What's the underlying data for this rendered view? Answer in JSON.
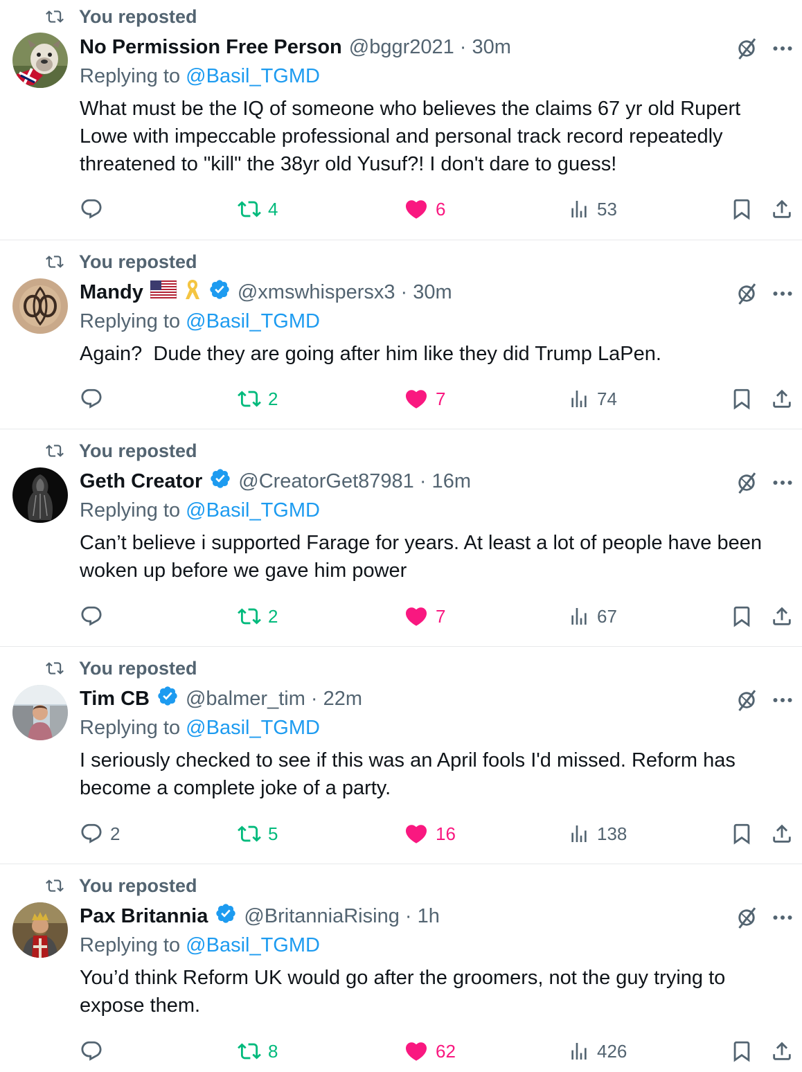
{
  "repost_label": "You reposted",
  "reply_prefix": "Replying to ",
  "icons": {
    "repost": "repost-icon",
    "reply": "reply-icon",
    "like": "heart-filled-icon",
    "views": "views-icon",
    "bookmark": "bookmark-icon",
    "share": "share-icon",
    "grok": "grok-icon",
    "more": "more-icon",
    "verified": "verified-badge-icon"
  },
  "colors": {
    "text": "#0f1419",
    "muted": "#536471",
    "link": "#1d9bf0",
    "repost_green": "#00ba7c",
    "like_pink": "#f91880",
    "divider": "#e7e9ea"
  },
  "posts": [
    {
      "name": "No Permission Free Person",
      "handle": "@bggr2021 · 30m",
      "reply_to": "@Basil_TGMD",
      "text": "What must be the IQ of someone who believes the claims 67 yr old Rupert Lowe with impeccable professional and personal track record repeatedly threatened to \"kill\" the 38yr old Yusuf?! I don't dare to guess!",
      "replies": "",
      "reposts": "4",
      "likes": "6",
      "views": "53"
    },
    {
      "name": "Mandy",
      "handle": "@xmswhispersx3 · 30m",
      "reply_to": "@Basil_TGMD",
      "text": "Again?  Dude they are going after him like they did Trump LaPen.",
      "replies": "",
      "reposts": "2",
      "likes": "7",
      "views": "74"
    },
    {
      "name": "Geth Creator",
      "handle": "@CreatorGet87981 · 16m",
      "reply_to": "@Basil_TGMD",
      "text": "Can’t believe i supported Farage for years. At least a lot of people have been woken up before we gave him power",
      "replies": "",
      "reposts": "2",
      "likes": "7",
      "views": "67"
    },
    {
      "name": "Tim CB",
      "handle": "@balmer_tim · 22m",
      "reply_to": "@Basil_TGMD",
      "text": "I seriously checked to see if this was an April fools I'd missed. Reform has become a complete joke of a party.",
      "replies": "2",
      "reposts": "5",
      "likes": "16",
      "views": "138"
    },
    {
      "name": "Pax Britannia",
      "handle": "@BritanniaRising · 1h",
      "reply_to": "@Basil_TGMD",
      "text": "You’d think Reform UK would go after the groomers, not the guy trying to expose them.",
      "replies": "",
      "reposts": "8",
      "likes": "62",
      "views": "426"
    }
  ]
}
